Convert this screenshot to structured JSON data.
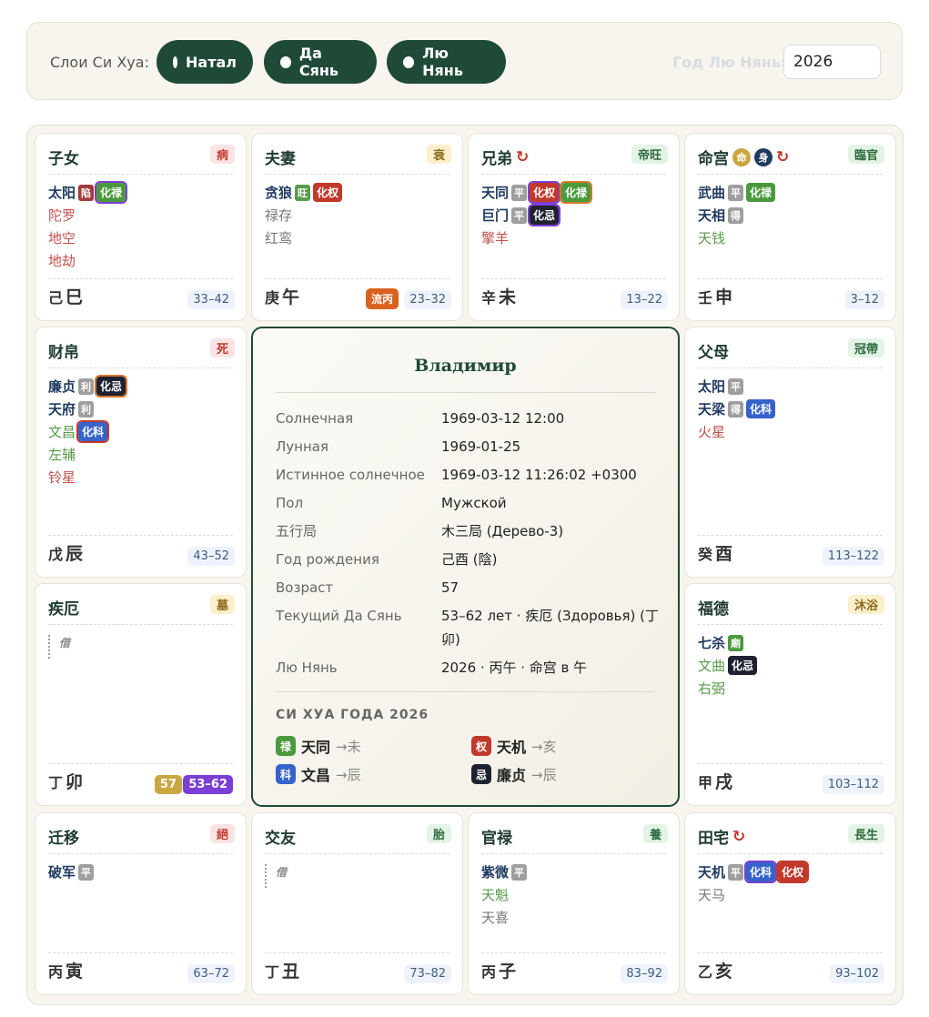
{
  "toolbar": {
    "label": "Слои Си Хуа:",
    "pills": [
      "Натал",
      "Да Сянь",
      "Лю Нянь"
    ],
    "year_label": "Год Лю Нянь:",
    "year_value": "2026"
  },
  "palaces": {
    "zinu": {
      "name": "子女",
      "stage": "病",
      "stars": [
        {
          "name": "太阳",
          "brightness": "陷",
          "hua": "化禄"
        },
        {
          "name": "陀罗"
        },
        {
          "name": "地空"
        },
        {
          "name": "地劫"
        }
      ],
      "stem": "己",
      "branch": "巳",
      "range": "33–42"
    },
    "fuqi": {
      "name": "夫妻",
      "stage": "衰",
      "stars": [
        {
          "name": "贪狼",
          "brightness": "旺",
          "hua": "化权"
        },
        {
          "name": "禄存"
        },
        {
          "name": "红鸾"
        }
      ],
      "stem": "庚",
      "branch": "午",
      "liu_tag": "流丙",
      "range": "23–32"
    },
    "xiongdi": {
      "name": "兄弟",
      "cycle": "↻",
      "stage": "帝旺",
      "stars": [
        {
          "name": "天同",
          "brightness": "平",
          "hua": [
            "化权",
            "化禄"
          ]
        },
        {
          "name": "巨门",
          "brightness": "平",
          "hua": "化忌"
        },
        {
          "name": "擎羊"
        }
      ],
      "stem": "辛",
      "branch": "未",
      "range": "13–22"
    },
    "ming": {
      "name": "命宫",
      "badge_life": "命",
      "badge_body": "身",
      "cycle": "↻",
      "stage": "臨官",
      "stars": [
        {
          "name": "武曲",
          "brightness": "平",
          "hua": "化禄"
        },
        {
          "name": "天相",
          "brightness": "得"
        },
        {
          "name": "天钱"
        }
      ],
      "stem": "壬",
      "branch": "申",
      "range": "3–12"
    },
    "caibo": {
      "name": "财帛",
      "stage": "死",
      "stars": [
        {
          "name": "廉贞",
          "brightness": "利",
          "hua": "化忌"
        },
        {
          "name": "天府",
          "brightness": "利"
        },
        {
          "name": "文昌",
          "hua": "化科"
        },
        {
          "name": "左辅"
        },
        {
          "name": "铃星"
        }
      ],
      "stem": "戊",
      "branch": "辰",
      "range": "43–52"
    },
    "fumu": {
      "name": "父母",
      "stage": "冠帶",
      "stars": [
        {
          "name": "太阳",
          "brightness": "平"
        },
        {
          "name": "天梁",
          "brightness": "得",
          "hua": "化科"
        },
        {
          "name": "火星"
        }
      ],
      "stem": "癸",
      "branch": "酉",
      "range": "113–122"
    },
    "jie": {
      "name": "疾厄",
      "stage": "墓",
      "borrow": "借",
      "stem": "丁",
      "branch": "卯",
      "age": "57",
      "range": "53–62"
    },
    "fude": {
      "name": "福德",
      "stage": "沐浴",
      "stars": [
        {
          "name": "七杀",
          "brightness": "廟"
        },
        {
          "name": "文曲",
          "hua": "化忌"
        },
        {
          "name": "右弼"
        }
      ],
      "stem": "甲",
      "branch": "戌",
      "range": "103–112"
    },
    "qianyi": {
      "name": "迁移",
      "stage": "絕",
      "stars": [
        {
          "name": "破军",
          "brightness": "平"
        }
      ],
      "stem": "丙",
      "branch": "寅",
      "range": "63–72"
    },
    "jiaoyou": {
      "name": "交友",
      "stage": "胎",
      "borrow": "借",
      "stem": "丁",
      "branch": "丑",
      "range": "73–82"
    },
    "guanlu": {
      "name": "官禄",
      "stage": "養",
      "stars": [
        {
          "name": "紫微",
          "brightness": "平"
        },
        {
          "name": "天魁"
        },
        {
          "name": "天喜"
        }
      ],
      "stem": "丙",
      "branch": "子",
      "range": "83–92"
    },
    "tianzhai": {
      "name": "田宅",
      "cycle": "↻",
      "stage": "長生",
      "stars": [
        {
          "name": "天机",
          "brightness": "平",
          "hua": [
            "化科",
            "化权"
          ]
        },
        {
          "name": "天马"
        }
      ],
      "stem": "乙",
      "branch": "亥",
      "range": "93–102"
    }
  },
  "center": {
    "name": "Владимир",
    "rows": [
      {
        "k": "Солнечная",
        "v": "1969-03-12 12:00"
      },
      {
        "k": "Лунная",
        "v": "1969-01-25"
      },
      {
        "k": "Истинное солнечное",
        "v": "1969-03-12 11:26:02 +0300"
      },
      {
        "k": "Пол",
        "v": "Мужской"
      },
      {
        "k": "五行局",
        "v": "木三局 (Дерево-3)"
      },
      {
        "k": "Год рождения",
        "v": "己酉 (陰)"
      },
      {
        "k": "Возраст",
        "v": "57"
      },
      {
        "k": "Текущий Да Сянь",
        "v": "53–62 лет · 疾厄 (Здоровья) (丁卯)"
      },
      {
        "k": "Лю Нянь",
        "v": "2026 · 丙午 · 命宫 в 午"
      }
    ],
    "sihua_title": "СИ ХУА ГОДА 2026",
    "sihua": [
      {
        "chip": "禄",
        "star": "天同",
        "target": "→未",
        "color": "#4a9a3d"
      },
      {
        "chip": "权",
        "star": "天机",
        "target": "→亥",
        "color": "#c0392b"
      },
      {
        "chip": "科",
        "star": "文昌",
        "target": "→辰",
        "color": "#3563c9"
      },
      {
        "chip": "忌",
        "star": "廉贞",
        "target": "→辰",
        "color": "#1e2230"
      }
    ]
  }
}
